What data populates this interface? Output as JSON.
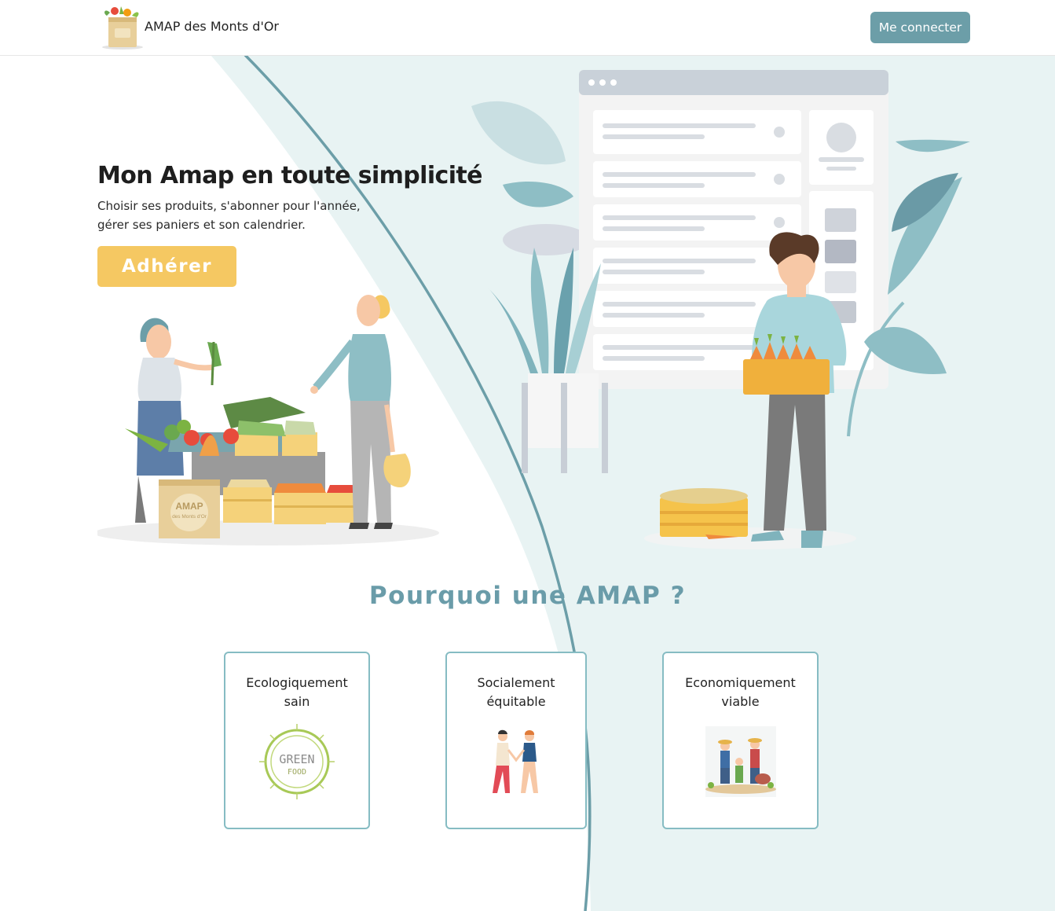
{
  "header": {
    "site_name": "AMAP des Monts d'Or",
    "login_label": "Me connecter",
    "logo_icon": "amap-grocery-bag-logo"
  },
  "hero": {
    "title": "Mon Amap en toute simplicité",
    "subtitle_line1": "Choisir ses produits, s'abonner pour l'année,",
    "subtitle_line2": "gérer ses paniers et son calendrier.",
    "cta_label": "Adhérer",
    "bag_label_top": "AMAP",
    "bag_label_bottom": "des Monts d'Or"
  },
  "why": {
    "title": "Pourquoi une AMAP ?",
    "cards": [
      {
        "line1": "Ecologiquement",
        "line2": "sain",
        "image_text_top": "GREEN",
        "image_text_bottom": "FOOD"
      },
      {
        "line1": "Socialement",
        "line2": "équitable"
      },
      {
        "line1": "Economiquement",
        "line2": "viable"
      }
    ]
  },
  "colors": {
    "accent_teal": "#6c9ea8",
    "cta_yellow": "#f5c862",
    "section_title": "#6a9ca9",
    "card_border": "#86bcc3",
    "bg_light_teal": "#e8f3f3"
  }
}
